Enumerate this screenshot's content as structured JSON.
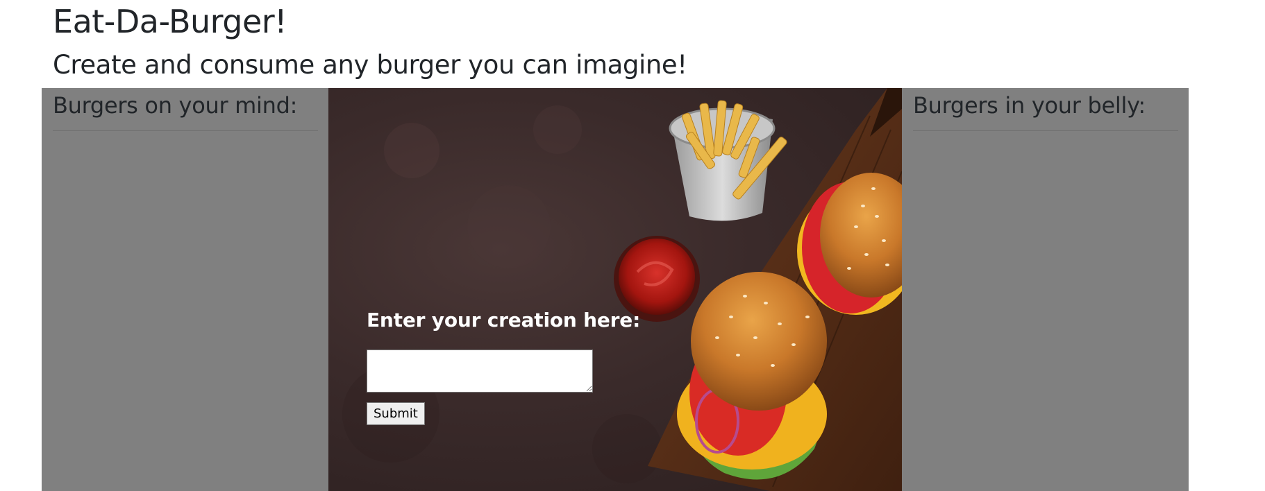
{
  "header": {
    "title": "Eat-Da-Burger!",
    "subtitle": "Create and consume any burger you can imagine!"
  },
  "left_column": {
    "heading": "Burgers on your mind:",
    "items": []
  },
  "right_column": {
    "heading": "Burgers in your belly:",
    "items": []
  },
  "form": {
    "label": "Enter your creation here:",
    "input_value": "",
    "submit_label": "Submit"
  },
  "colors": {
    "panel_background": "#808080",
    "hero_background": "#3a2a2a",
    "heading_text": "#212529",
    "form_label_text": "#ffffff"
  },
  "hero_image": {
    "icons": [
      "fries-bucket-icon",
      "ketchup-bowl-icon",
      "burger-icon",
      "cutting-board-icon"
    ]
  }
}
